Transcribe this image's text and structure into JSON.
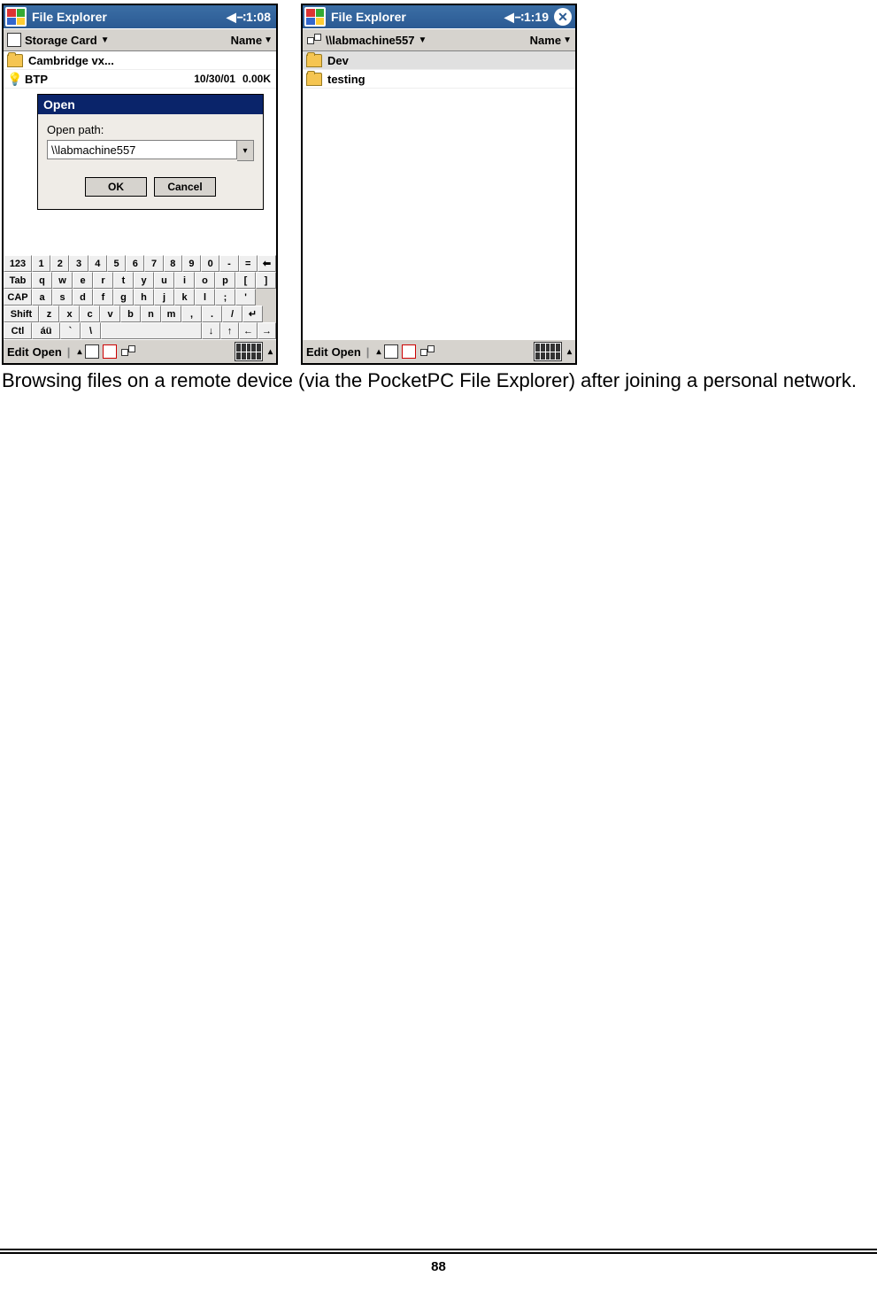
{
  "left": {
    "title": "File Explorer",
    "clock": "1:08",
    "location": "Storage Card",
    "sort": "Name",
    "rows": [
      {
        "kind": "folder",
        "name": "Cambridge vx..."
      },
      {
        "kind": "bulb",
        "name": "BTP",
        "date": "10/30/01",
        "size": "0.00K"
      }
    ],
    "dialog": {
      "title": "Open",
      "label": "Open path:",
      "value": "\\\\labmachine557",
      "ok": "OK",
      "cancel": "Cancel"
    },
    "keyboard": {
      "r1": [
        "123",
        "1",
        "2",
        "3",
        "4",
        "5",
        "6",
        "7",
        "8",
        "9",
        "0",
        "-",
        "=",
        "⬅"
      ],
      "r2": [
        "Tab",
        "q",
        "w",
        "e",
        "r",
        "t",
        "y",
        "u",
        "i",
        "o",
        "p",
        "[",
        "]"
      ],
      "r3": [
        "CAP",
        "a",
        "s",
        "d",
        "f",
        "g",
        "h",
        "j",
        "k",
        "l",
        ";",
        "'"
      ],
      "r4": [
        "Shift",
        "z",
        "x",
        "c",
        "v",
        "b",
        "n",
        "m",
        ",",
        ".",
        "/",
        "↵"
      ],
      "r5": [
        "Ctl",
        "áü",
        "`",
        "\\",
        "↓",
        "↑",
        "←",
        "→"
      ]
    },
    "bottom": {
      "a": "Edit",
      "b": "Open"
    }
  },
  "right": {
    "title": "File Explorer",
    "clock": "1:19",
    "location": "\\\\labmachine557",
    "sort": "Name",
    "rows": [
      {
        "kind": "folder",
        "name": "Dev"
      },
      {
        "kind": "folder",
        "name": "testing"
      }
    ],
    "bottom": {
      "a": "Edit",
      "b": "Open"
    }
  },
  "caption": "Browsing files on a remote device (via the PocketPC File Explorer) after joining a personal network.",
  "page_number": "88"
}
